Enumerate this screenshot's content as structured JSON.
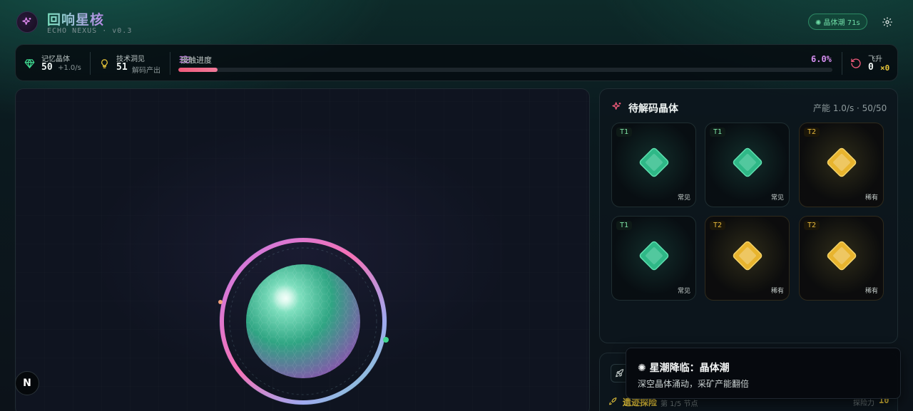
{
  "header": {
    "title": "回响星核",
    "subtitle": "ECHO NEXUS · v0.3",
    "tide_badge": "✺ 晶体潮 71s",
    "logo_icon": "sparkles-icon",
    "settings_icon": "gear-icon"
  },
  "stats": {
    "memory": {
      "label": "记忆晶体",
      "value": "50",
      "rate": "+1.0/s",
      "icon": "gem-icon"
    },
    "insight": {
      "label": "技术洞见",
      "value": "51",
      "note": "解码产出",
      "icon": "lightbulb-icon"
    },
    "contact": {
      "label": "接触进度",
      "percent_text": "6.0%",
      "progress": 0.06,
      "icon": "waves-icon"
    },
    "ascend": {
      "label": "飞升",
      "value": "0",
      "multiplier": "×0",
      "icon": "refresh-icon"
    }
  },
  "crystal_panel": {
    "title": "待解码晶体",
    "meta": "产能 1.0/s · 50/50",
    "icon": "sparkles-icon",
    "crystals": [
      {
        "tier": "T1",
        "rarity": "常见",
        "kind": "common"
      },
      {
        "tier": "T1",
        "rarity": "常见",
        "kind": "common"
      },
      {
        "tier": "T2",
        "rarity": "稀有",
        "kind": "rare"
      },
      {
        "tier": "T1",
        "rarity": "常见",
        "kind": "common"
      },
      {
        "tier": "T2",
        "rarity": "稀有",
        "kind": "rare"
      },
      {
        "tier": "T2",
        "rarity": "稀有",
        "kind": "rare"
      }
    ]
  },
  "expedition": {
    "label": "遗迹探险",
    "sub": "第 1/5 节点",
    "power_label": "探险力",
    "power_value": "10"
  },
  "toast": {
    "title": "✺ 星潮降临：晶体潮",
    "body": "深空晶体涌动，采矿产能翻倍"
  },
  "corner_button": {
    "label": "N"
  },
  "colors": {
    "accent_teal": "#6fdca6",
    "accent_pink": "#f05a7a",
    "accent_purple": "#d58ef0",
    "rare_gold": "#e8b93a"
  }
}
